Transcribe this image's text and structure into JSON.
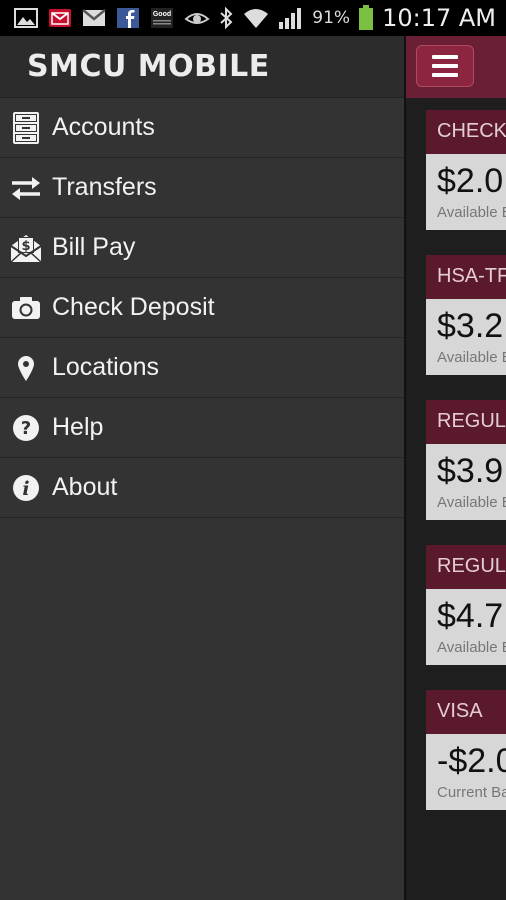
{
  "status_bar": {
    "battery_percent": "91%",
    "time": "10:17 AM",
    "notification_icons": [
      "gallery-icon",
      "mail-red-icon",
      "gmail-icon",
      "facebook-icon",
      "good-icon"
    ],
    "system_icons": [
      "eye-icon",
      "bluetooth-icon",
      "wifi-icon",
      "signal-icon",
      "battery-icon"
    ]
  },
  "drawer": {
    "title": "SMCU MOBILE",
    "items": [
      {
        "label": "Accounts",
        "icon": "filing-cabinet-icon"
      },
      {
        "label": "Transfers",
        "icon": "transfer-arrows-icon"
      },
      {
        "label": "Bill Pay",
        "icon": "bill-envelope-icon"
      },
      {
        "label": "Check Deposit",
        "icon": "camera-icon"
      },
      {
        "label": "Locations",
        "icon": "map-pin-icon"
      },
      {
        "label": "Help",
        "icon": "help-icon"
      },
      {
        "label": "About",
        "icon": "info-icon"
      }
    ]
  },
  "accounts": [
    {
      "name": "CHECKI",
      "amount": "$2.0",
      "sub": "Available B"
    },
    {
      "name": "HSA-TF",
      "amount": "$3.2",
      "sub": "Available B"
    },
    {
      "name": "REGULA",
      "amount": "$3.9",
      "sub": "Available B"
    },
    {
      "name": "REGULA",
      "amount": "$4.7",
      "sub": "Available B"
    },
    {
      "name": "VISA",
      "amount": "-$2.0",
      "sub": "Current Ba"
    }
  ],
  "colors": {
    "accent": "#6a1f35",
    "card_header": "#5b1a2c",
    "drawer_bg": "#333333"
  }
}
